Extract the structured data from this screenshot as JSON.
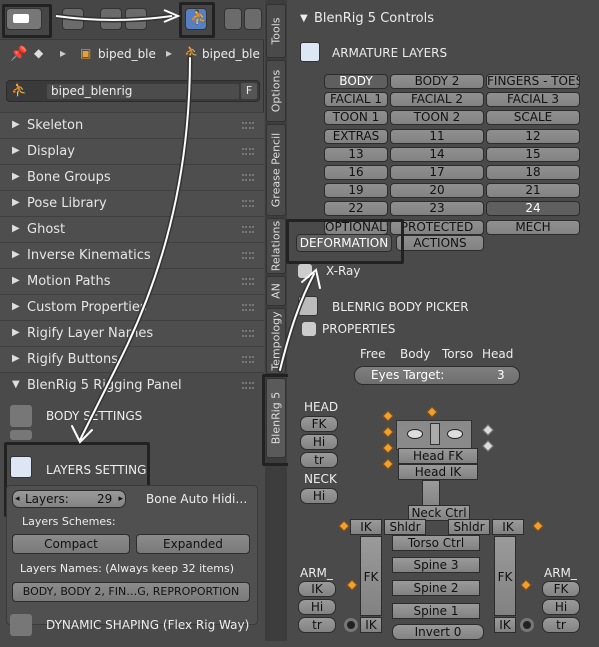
{
  "left": {
    "breadcrumb": {
      "item1": "biped_ble",
      "item2": "biped_ble"
    },
    "object_field": {
      "value": "biped_blenrig",
      "fake_user": "F"
    },
    "panels": [
      "Skeleton",
      "Display",
      "Bone Groups",
      "Pose Library",
      "Ghost",
      "Inverse Kinematics",
      "Motion Paths",
      "Custom Properties",
      "Rigify Layer Names",
      "Rigify Buttons"
    ],
    "rigging_panel": {
      "title": "BlenRig 5 Rigging Panel",
      "body_settings": "BODY SETTINGS",
      "layers_setting": "LAYERS SETTING",
      "layers_label": "Layers:",
      "layers_value": "29",
      "bone_auto_hide": "Bone Auto Hidi…",
      "layers_schemes": "Layers Schemes:",
      "compact": "Compact",
      "expanded": "Expanded",
      "layers_names": "Layers Names: (Always keep 32 items)",
      "names_value": "BODY, BODY 2, FIN…G, REPROPORTION",
      "dynamic_shaping": "DYNAMIC SHAPING (Flex Rig Way)"
    }
  },
  "tabs": [
    "Tools",
    "Options",
    "Grease Pencil",
    "Relations",
    "AN",
    "Tempology",
    "BlenRig 5"
  ],
  "right": {
    "title": "BlenRig 5 Controls",
    "armature_layers": "ARMATURE LAYERS",
    "layer_buttons": [
      [
        "BODY",
        "BODY 2",
        "FINGERS - TOES"
      ],
      [
        "FACIAL 1",
        "FACIAL 2",
        "FACIAL 3"
      ],
      [
        "TOON 1",
        "TOON 2",
        "SCALE"
      ],
      [
        "EXTRAS",
        "11",
        "12"
      ],
      [
        "13",
        "14",
        "15"
      ],
      [
        "16",
        "17",
        "18"
      ],
      [
        "19",
        "20",
        "21"
      ],
      [
        "22",
        "23",
        "24"
      ],
      [
        "OPTIONALS",
        "PROTECTED",
        "MECH"
      ]
    ],
    "deformation": "DEFORMATION",
    "actions": "ACTIONS",
    "xray": "X-Ray",
    "body_picker": "BLENRIG BODY PICKER",
    "properties": "PROPERTIES",
    "eyes_header": [
      "Free",
      "Body",
      "Torso",
      "Head"
    ],
    "eyes_target": "Eyes Target:",
    "eyes_target_value": "3",
    "head_label": "HEAD",
    "neck_label": "NECK",
    "fk": "FK",
    "hi": "Hi",
    "tr": "tr",
    "ik": "IK",
    "head_fk": "Head FK",
    "head_ik": "Head IK",
    "neck_ctrl": "Neck Ctrl",
    "shldr": "Shldr",
    "torso_ctrl": "Torso Ctrl",
    "spine3": "Spine 3",
    "spine2": "Spine 2",
    "spine1": "Spine 1",
    "invert0": "Invert 0",
    "arm_l": "ARM_",
    "arm_r": "ARM_"
  },
  "colors": {
    "accent": "#5680c2",
    "diamond": "#f0a030",
    "highlight_border": "#222222"
  }
}
